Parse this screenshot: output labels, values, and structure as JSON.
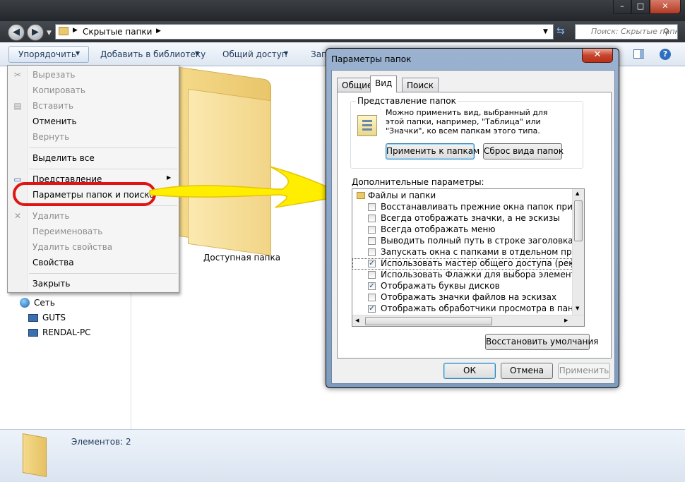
{
  "explorer": {
    "breadcrumb": "Скрытые папки",
    "search_placeholder": "Поиск: Скрытые папки",
    "toolbar": {
      "organize": "Упорядочить",
      "add_to_library": "Добавить в библиотеку",
      "share": "Общий доступ",
      "burn_partial": "Запи"
    },
    "nav": {
      "network": "Сеть",
      "items": [
        "GUTS",
        "RENDAL-PC"
      ]
    },
    "folder_label": "Доступная папка",
    "status": "Элементов: 2"
  },
  "context_menu": {
    "items": [
      {
        "label": "Вырезать",
        "disabled": true
      },
      {
        "label": "Копировать",
        "disabled": true
      },
      {
        "label": "Вставить",
        "disabled": true
      },
      {
        "label": "Отменить",
        "disabled": false
      },
      {
        "label": "Вернуть",
        "disabled": true
      },
      {
        "label": "Выделить все",
        "disabled": false
      },
      {
        "label": "Представление",
        "disabled": false
      },
      {
        "label": "Параметры папок и поиска",
        "disabled": false
      },
      {
        "label": "Удалить",
        "disabled": true
      },
      {
        "label": "Переименовать",
        "disabled": true
      },
      {
        "label": "Удалить свойства",
        "disabled": true
      },
      {
        "label": "Свойства",
        "disabled": false
      },
      {
        "label": "Закрыть",
        "disabled": false
      }
    ]
  },
  "dialog": {
    "title": "Параметры папок",
    "close": "✕",
    "tabs": [
      "Общие",
      "Вид",
      "Поиск"
    ],
    "active_tab": "Вид",
    "view_group": {
      "caption": "Представление папок",
      "text": "Можно применить вид, выбранный для этой папки, например, \"Таблица\" или \"Значки\", ко всем папкам этого типа.",
      "apply_button": "Применить к папкам",
      "reset_button": "Сброс вида папок"
    },
    "advanced_caption": "Дополнительные параметры:",
    "tree_root": "Файлы и папки",
    "options": [
      {
        "label": "Восстанавливать прежние окна папок при входе в систему",
        "checked": false
      },
      {
        "label": "Всегда отображать значки, а не эскизы",
        "checked": false
      },
      {
        "label": "Всегда отображать меню",
        "checked": false
      },
      {
        "label": "Выводить полный путь в строке заголовка (только для классической темы)",
        "checked": false
      },
      {
        "label": "Запускать окна с папками в отдельном процессе",
        "checked": false
      },
      {
        "label": "Использовать мастер общего доступа (рекомендуется)",
        "checked": true
      },
      {
        "label": "Использовать Флажки для выбора элементов",
        "checked": false
      },
      {
        "label": "Отображать буквы дисков",
        "checked": true
      },
      {
        "label": "Отображать значки файлов на эскизах",
        "checked": false
      },
      {
        "label": "Отображать обработчики просмотра в панели просмотра",
        "checked": true
      }
    ],
    "restore_defaults": "Восстановить умолчания",
    "ok": "ОК",
    "cancel": "Отмена",
    "apply": "Применить"
  },
  "colors": {
    "highlight_ring": "#e01414",
    "arrow": "#ffee00",
    "dialog_frame": "#8aa6c8"
  }
}
